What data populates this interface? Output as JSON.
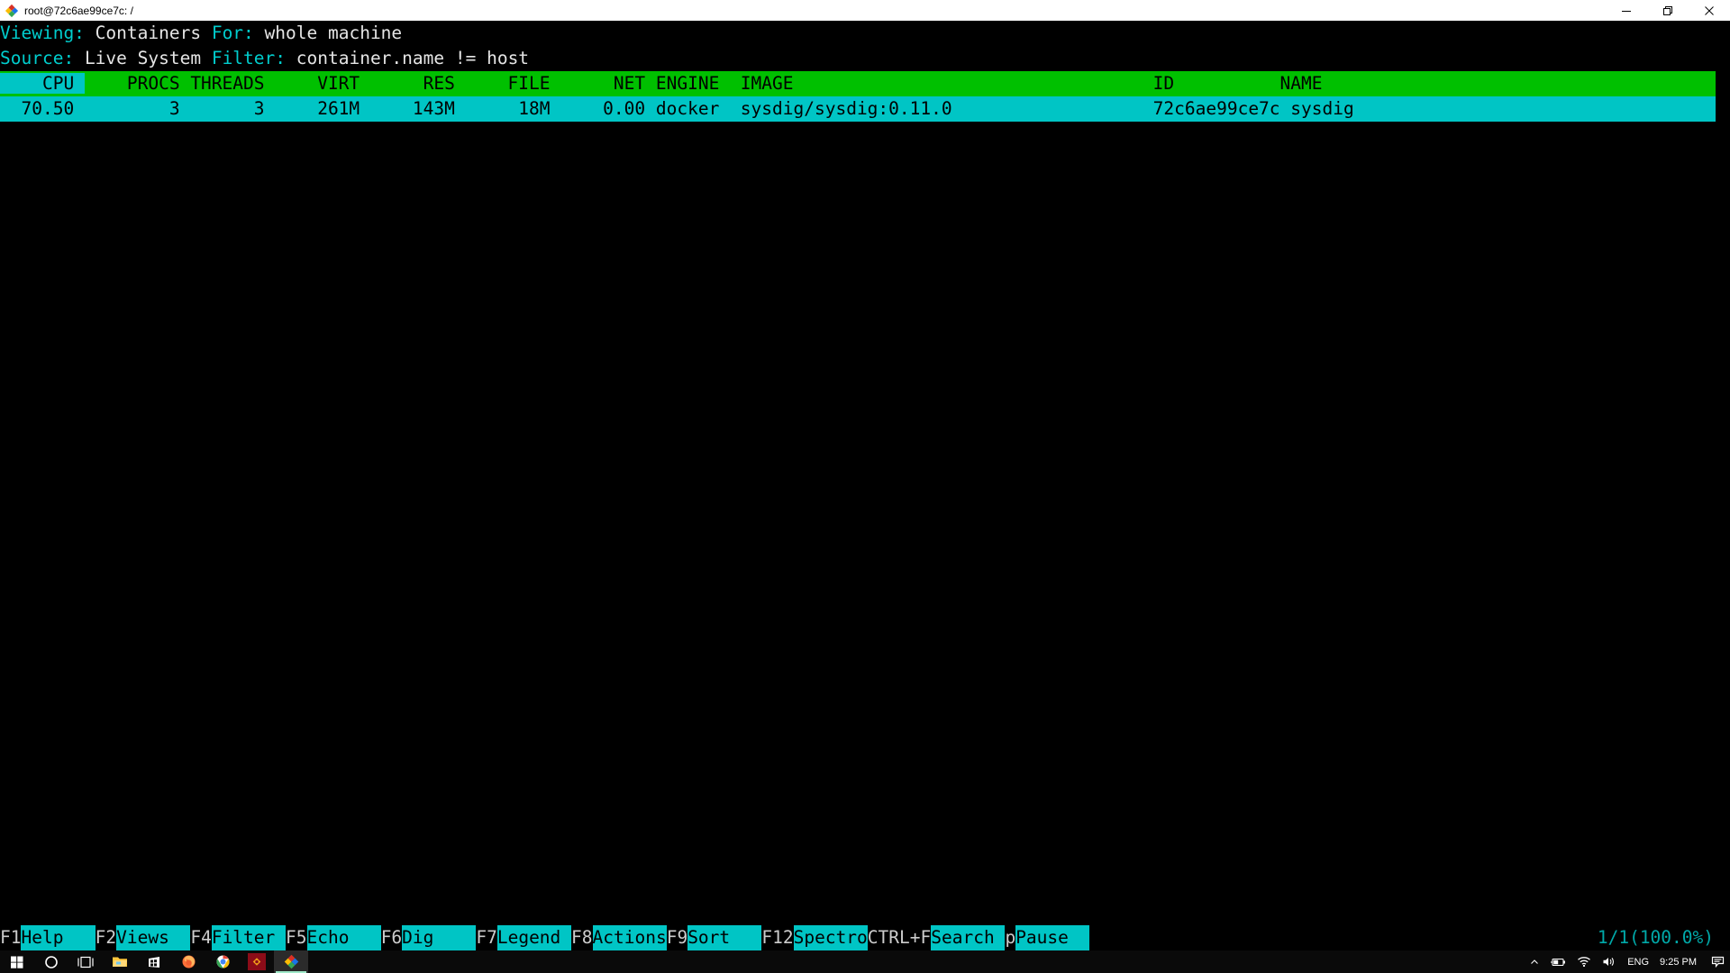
{
  "window": {
    "title": "root@72c6ae99ce7c: /",
    "icon": "putty-icon",
    "minimize_label": "—",
    "restore_label": "❐",
    "close_label": "✕"
  },
  "header": {
    "viewing_label": "Viewing:",
    "viewing_value": "Containers",
    "for_label": "For:",
    "for_value": "whole machine",
    "source_label": "Source:",
    "source_value": "Live System",
    "filter_label": "Filter:",
    "filter_value": "container.name != host"
  },
  "table": {
    "sort_column": "CPU",
    "columns": [
      {
        "key": "cpu",
        "label": "CPU"
      },
      {
        "key": "procs",
        "label": "PROCS"
      },
      {
        "key": "threads",
        "label": "THREADS"
      },
      {
        "key": "virt",
        "label": "VIRT"
      },
      {
        "key": "res",
        "label": "RES"
      },
      {
        "key": "file",
        "label": "FILE"
      },
      {
        "key": "net",
        "label": "NET"
      },
      {
        "key": "engine",
        "label": "ENGINE"
      },
      {
        "key": "image",
        "label": "IMAGE"
      },
      {
        "key": "id",
        "label": "ID"
      },
      {
        "key": "name",
        "label": "NAME"
      }
    ],
    "header_line": "    CPU     PROCS THREADS     VIRT      RES     FILE      NET ENGINE  IMAGE                                  ID          NAME                                          ",
    "header_sort_segment": "    CPU ",
    "header_rest_segment": "    PROCS THREADS     VIRT      RES     FILE      NET ENGINE  IMAGE                                  ID          NAME                                          ",
    "rows": [
      {
        "line": "  70.50         3       3     261M     143M      18M     0.00 docker  sysdig/sysdig:0.11.0                   72c6ae99ce7c sysdig                                        ",
        "cpu": "70.50",
        "procs": "3",
        "threads": "3",
        "virt": "261M",
        "res": "143M",
        "file": "18M",
        "net": "0.00",
        "engine": "docker",
        "image": "sysdig/sysdig:0.11.0",
        "id": "72c6ae99ce7c",
        "name": "sysdig",
        "selected": true
      }
    ]
  },
  "function_keys": [
    {
      "key": "F1",
      "label": "Help   "
    },
    {
      "key": "F2",
      "label": "Views  "
    },
    {
      "key": "F4",
      "label": "Filter "
    },
    {
      "key": "F5",
      "label": "Echo   "
    },
    {
      "key": "F6",
      "label": "Dig    "
    },
    {
      "key": "F7",
      "label": "Legend "
    },
    {
      "key": "F8",
      "label": "Actions"
    },
    {
      "key": "F9",
      "label": "Sort   "
    },
    {
      "key": "F12",
      "label": "Spectro"
    },
    {
      "key": "CTRL+F",
      "label": "Search "
    },
    {
      "key": "p",
      "label": "Pause  "
    }
  ],
  "status": {
    "position": "1/1(100.0%)"
  },
  "scrollbar": {
    "down_arrow": "⌄"
  },
  "taskbar": {
    "items": [
      {
        "name": "start-button",
        "label": "Start"
      },
      {
        "name": "cortana-button",
        "label": "Cortana"
      },
      {
        "name": "task-view-button",
        "label": "Task View"
      },
      {
        "name": "file-explorer-button",
        "label": "File Explorer"
      },
      {
        "name": "microsoft-store-button",
        "label": "Microsoft Store"
      },
      {
        "name": "firefox-button",
        "label": "Firefox"
      },
      {
        "name": "chrome-button",
        "label": "Google Chrome"
      },
      {
        "name": "app-red-button",
        "label": "Application"
      },
      {
        "name": "putty-button",
        "label": "PuTTY"
      }
    ],
    "tray": {
      "show_hidden": "˄",
      "battery": "battery-icon",
      "network": "wifi-icon",
      "volume": "volume-icon",
      "language": "ENG",
      "time": "9:25 PM",
      "action_center": "notification-icon"
    }
  },
  "colors": {
    "header_green": "#00c000",
    "accent_cyan": "#00c5c5",
    "label_cyan": "#00cdcd",
    "status_teal": "#00a9a9",
    "terminal_bg": "#000000",
    "terminal_fg": "#cccccc"
  }
}
